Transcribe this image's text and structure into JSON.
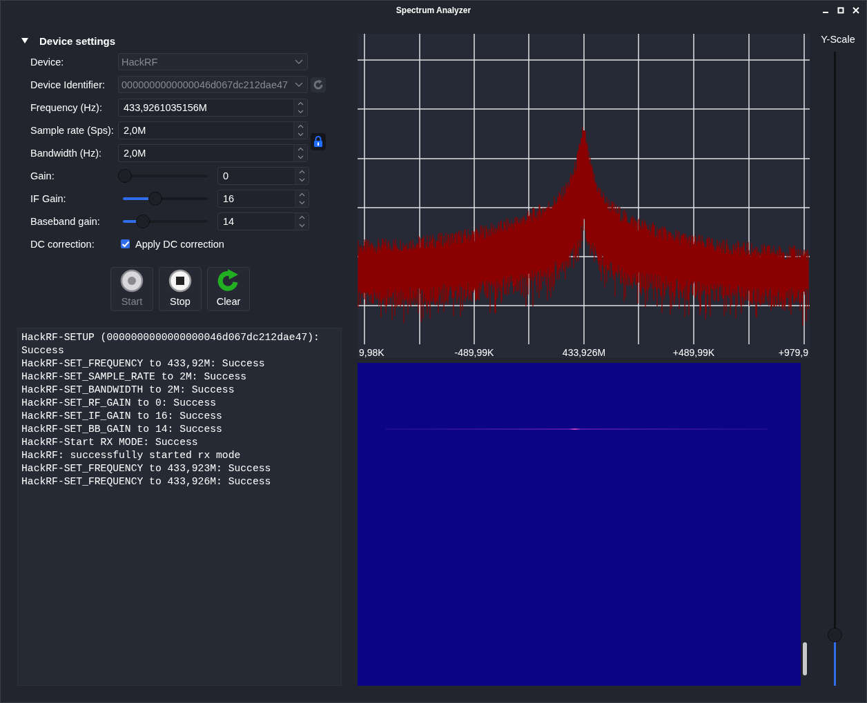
{
  "window": {
    "title": "Spectrum Analyzer"
  },
  "settings": {
    "title": "Device settings",
    "expanded": true,
    "rows": [
      {
        "kind": "combo",
        "label": "Device:",
        "value": "HackRF",
        "disabled": true
      },
      {
        "kind": "combo",
        "label": "Device Identifier:",
        "value": "0000000000000046d067dc212dae47",
        "disabled": true
      },
      {
        "kind": "spin",
        "label": "Frequency (Hz):",
        "value": "433,9261035156M"
      },
      {
        "kind": "spin",
        "label": "Sample rate (Sps):",
        "value": "2,0M"
      },
      {
        "kind": "spin",
        "label": "Bandwidth (Hz):",
        "value": "2,0M"
      },
      {
        "kind": "slider",
        "label": "Gain:",
        "level": 0,
        "value": "0"
      },
      {
        "kind": "slider",
        "label": "IF Gain:",
        "level": 0.4,
        "value": "16"
      },
      {
        "kind": "slider",
        "label": "Baseband gain:",
        "level": 0.24,
        "value": "14"
      },
      {
        "kind": "check",
        "label": "DC correction:",
        "text": "Apply DC correction",
        "checked": true
      }
    ]
  },
  "buttons": [
    {
      "kind": "start",
      "label": "Start",
      "disabled": true
    },
    {
      "kind": "stop",
      "label": "Stop",
      "disabled": false
    },
    {
      "kind": "clear",
      "label": "Clear",
      "disabled": false
    }
  ],
  "log": [
    "HackRF-SETUP (0000000000000000046d067dc212dae47): Success",
    "HackRF-SET_FREQUENCY to 433,92M: Success",
    "HackRF-SET_SAMPLE_RATE to 2M: Success",
    "HackRF-SET_BANDWIDTH to 2M: Success",
    "HackRF-SET_RF_GAIN to 0: Success",
    "HackRF-SET_IF_GAIN to 16: Success",
    "HackRF-SET_BB_GAIN to 14: Success",
    "HackRF-Start RX MODE: Success",
    "HackRF: successfully started rx mode",
    "HackRF-SET_FREQUENCY to 433,923M: Success",
    "HackRF-SET_FREQUENCY to 433,926M: Success"
  ],
  "spectrum": {
    "x_labels": [
      "9,98K",
      "-489,99K",
      "433,926M",
      "+489,99K",
      "+979,9"
    ]
  },
  "y_scale": {
    "label": "Y-Scale",
    "level": 0.07
  }
}
